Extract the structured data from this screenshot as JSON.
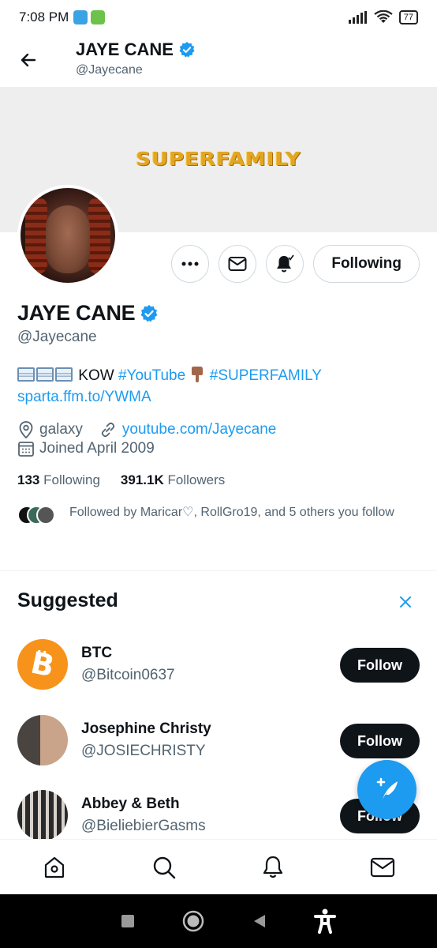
{
  "status_bar": {
    "time": "7:08 PM",
    "battery": "77"
  },
  "header": {
    "name": "JAYE CANE",
    "handle": "@Jayecane"
  },
  "banner": {
    "logo_text": "SUPERFAMILY"
  },
  "actions": {
    "following_label": "Following"
  },
  "profile": {
    "name": "JAYE CANE",
    "handle": "@Jayecane",
    "bio_line1_text": "KOW",
    "bio_hashtag1": "#YouTube",
    "bio_hashtag2": "#SUPERFAMILY",
    "bio_link": "sparta.ffm.to/YWMA",
    "location": "galaxy",
    "website": "youtube.com/Jayecane",
    "joined": "Joined April 2009",
    "following_count": "133",
    "following_label": "Following",
    "followers_count": "391.1K",
    "followers_label": "Followers",
    "followed_by": "Followed by Maricar♡, RollGro19, and 5 others you follow"
  },
  "suggested": {
    "title": "Suggested",
    "accounts": [
      {
        "name": "BTC",
        "handle": "@Bitcoin0637",
        "button": "Follow"
      },
      {
        "name": "Josephine Christy",
        "handle": "@JOSIECHRISTY",
        "button": "Follow"
      },
      {
        "name": "Abbey & Beth",
        "handle": "@BieliebierGasms",
        "button": "Follow"
      }
    ]
  },
  "colors": {
    "accent": "#1d9bf0",
    "text_primary": "#0f1419",
    "text_secondary": "#536471",
    "bitcoin_orange": "#f7931a"
  },
  "icons": {
    "back": "arrow-left-icon",
    "verified": "verified-badge-icon",
    "more": "more-icon",
    "message": "envelope-icon",
    "notify": "bell-icon",
    "location": "location-pin-icon",
    "link": "link-icon",
    "calendar": "calendar-icon",
    "close": "close-icon",
    "compose": "compose-icon",
    "nav_home": "home-icon",
    "nav_search": "search-icon",
    "nav_notifications": "bell-icon",
    "nav_messages": "envelope-icon"
  }
}
